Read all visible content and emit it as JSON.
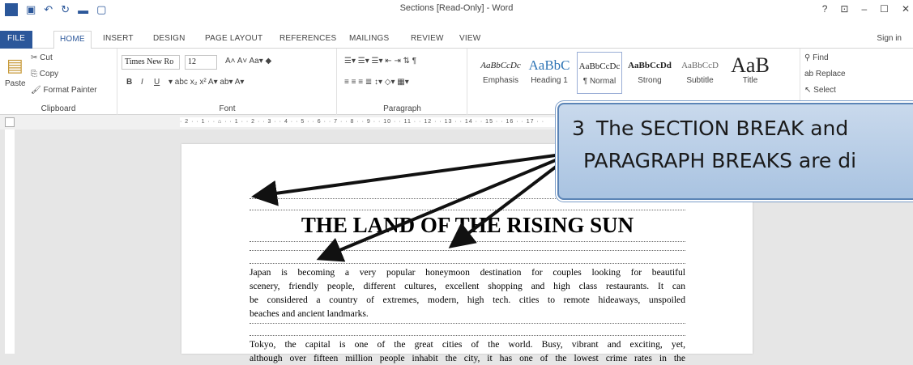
{
  "window": {
    "title": "Sections [Read-Only] - Word",
    "controls": [
      "?",
      "⊡",
      "–",
      "☐",
      "✕"
    ]
  },
  "tabs": [
    "FILE",
    "HOME",
    "INSERT",
    "DESIGN",
    "PAGE LAYOUT",
    "REFERENCES",
    "MAILINGS",
    "REVIEW",
    "VIEW"
  ],
  "sign_in": "Sign in",
  "clipboard": {
    "paste": "Paste",
    "cut": "Cut",
    "copy": "Copy",
    "format_painter": "Format Painter",
    "label": "Clipboard"
  },
  "font": {
    "name": "Times New Ro",
    "size": "12",
    "label": "Font",
    "bold": "B",
    "italic": "I",
    "underline": "U"
  },
  "paragraph": {
    "label": "Paragraph"
  },
  "styles": [
    {
      "preview": "AaBbCcDc",
      "name": "Emphasis"
    },
    {
      "preview": "AaBbC",
      "name": "Heading 1"
    },
    {
      "preview": "AaBbCcDc",
      "name": "¶ Normal"
    },
    {
      "preview": "AaBbCcDd",
      "name": "Strong"
    },
    {
      "preview": "AaBbCcD",
      "name": "Subtitle"
    },
    {
      "preview": "AaB",
      "name": "Title"
    }
  ],
  "editing": {
    "find": "Find",
    "replace": "Replace",
    "select": "Select"
  },
  "document": {
    "heading": "THE LAND OF THE RISING SUN",
    "para1_lines": [
      "Japan is becoming a very popular honeymoon destination for couples looking for beautiful",
      "scenery, friendly people, different cultures, excellent shopping and high class restaurants. It can",
      "be considered a country of extremes, modern, high tech. cities to remote hideaways, unspoiled",
      "beaches and ancient landmarks."
    ],
    "para2_lines": [
      "Tokyo, the capital is one of the great cities of the world. Busy, vibrant and exciting, yet,",
      "although over fifteen million people inhabit the city, it has one of the lowest crime rates in the"
    ]
  },
  "callout": {
    "number": "3",
    "line1": "The SECTION BREAK and",
    "line2": "PARAGRAPH BREAKS are di"
  },
  "colors": {
    "accent": "#2b579a",
    "callout_border": "#5b84b6"
  }
}
